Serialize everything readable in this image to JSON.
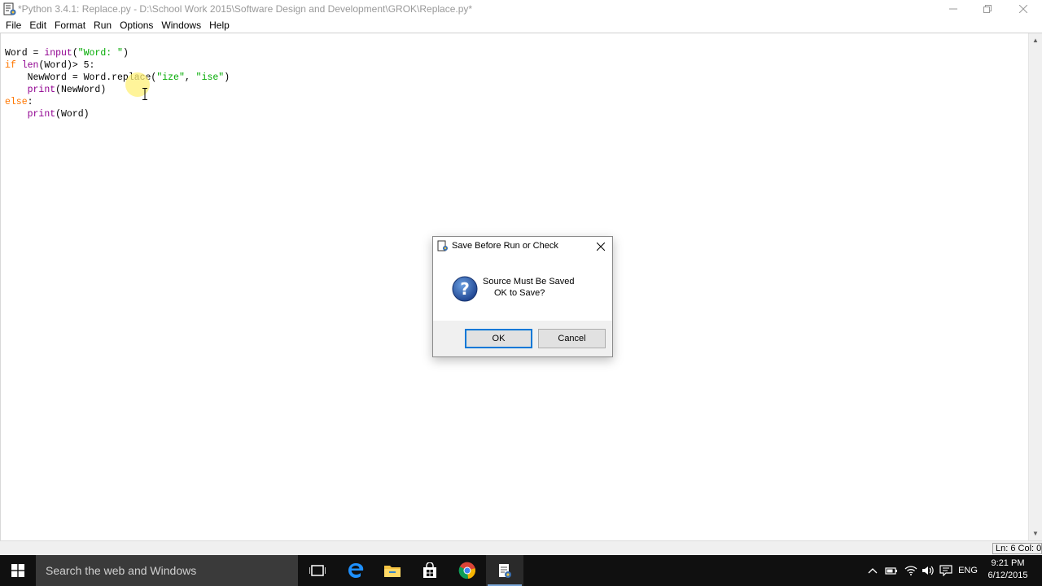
{
  "window": {
    "title": "*Python 3.4.1: Replace.py - D:\\School Work 2015\\Software Design and Development\\GROK\\Replace.py*"
  },
  "menu": {
    "items": [
      "File",
      "Edit",
      "Format",
      "Run",
      "Options",
      "Windows",
      "Help"
    ]
  },
  "code": {
    "lines": [
      [
        {
          "t": "Word = ",
          "c": "df"
        },
        {
          "t": "input",
          "c": "bi"
        },
        {
          "t": "(",
          "c": "df"
        },
        {
          "t": "\"Word: \"",
          "c": "st"
        },
        {
          "t": ")",
          "c": "df"
        }
      ],
      [
        {
          "t": "if ",
          "c": "kw"
        },
        {
          "t": "len",
          "c": "bi"
        },
        {
          "t": "(Word)> 5:",
          "c": "df"
        }
      ],
      [
        {
          "t": "    NewWord = Word.replace(",
          "c": "df"
        },
        {
          "t": "\"ize\"",
          "c": "st"
        },
        {
          "t": ", ",
          "c": "df"
        },
        {
          "t": "\"ise\"",
          "c": "st"
        },
        {
          "t": ")",
          "c": "df"
        }
      ],
      [
        {
          "t": "    ",
          "c": "df"
        },
        {
          "t": "print",
          "c": "bi"
        },
        {
          "t": "(NewWord)",
          "c": "df"
        }
      ],
      [
        {
          "t": "else",
          "c": "kw"
        },
        {
          "t": ":",
          "c": "df"
        }
      ],
      [
        {
          "t": "    ",
          "c": "df"
        },
        {
          "t": "print",
          "c": "bi"
        },
        {
          "t": "(Word)",
          "c": "df"
        }
      ]
    ]
  },
  "status": {
    "position": "Ln: 6  Col: 0"
  },
  "dialog": {
    "title": "Save Before Run or Check",
    "message_line1": "Source Must Be Saved",
    "message_line2": "OK to Save?",
    "ok_label": "OK",
    "cancel_label": "Cancel"
  },
  "taskbar": {
    "search_placeholder": "Search the web and Windows",
    "language": "ENG",
    "time": "9:21 PM",
    "date": "6/12/2015"
  },
  "colors": {
    "keyword": "#ff7700",
    "builtin": "#900090",
    "string": "#00aa00",
    "taskbar": "#101010",
    "accent": "#0078d7"
  }
}
